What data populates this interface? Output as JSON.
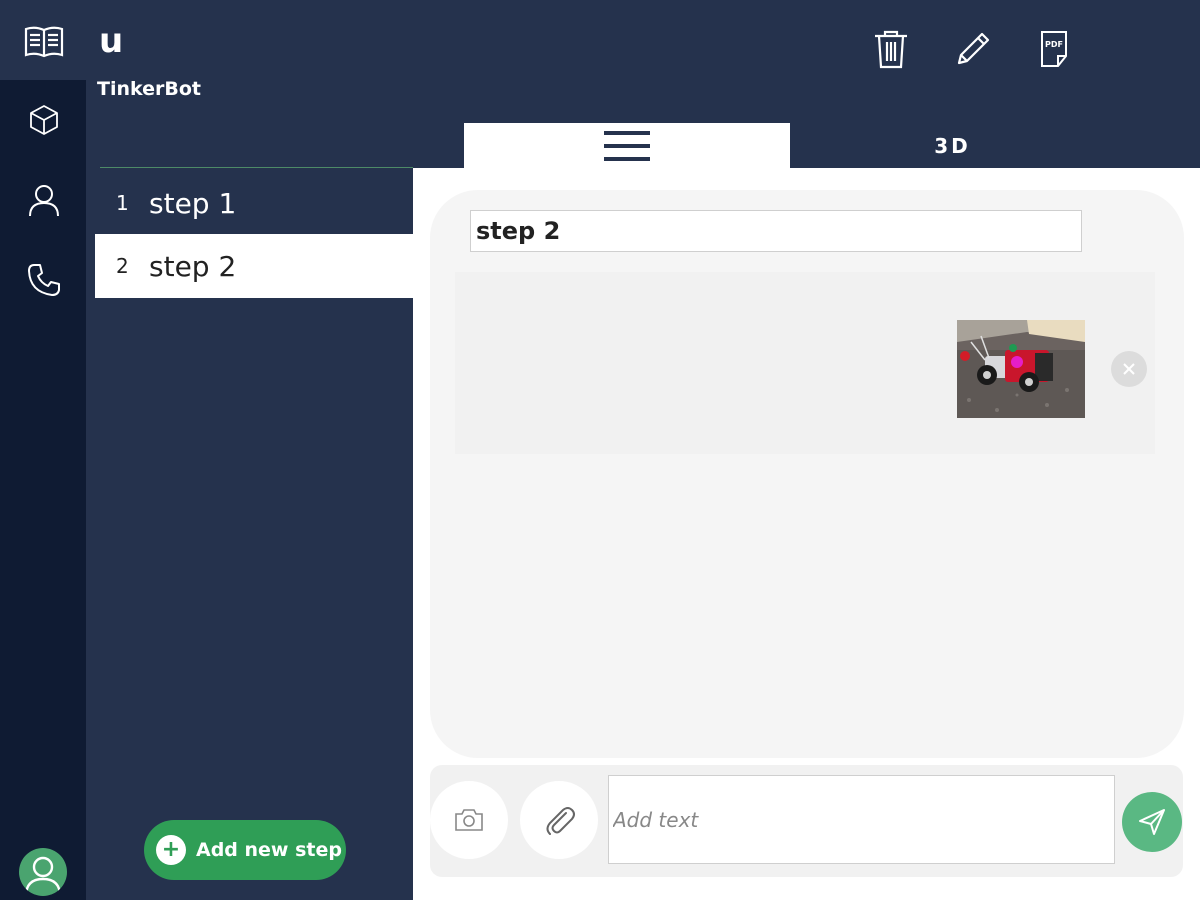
{
  "header": {
    "project_letter": "u",
    "project_name": "TinkerBot"
  },
  "nav_rail": {
    "icons": [
      "book-icon",
      "cube-icon",
      "user-icon",
      "phone-icon",
      "avatar"
    ]
  },
  "toolbar": {
    "icons": [
      "trash-icon",
      "pencil-icon",
      "pdf-icon"
    ]
  },
  "tabs": {
    "list_tab_icon": "hamburger-icon",
    "model_tab_label": "3D",
    "active": "list"
  },
  "steps": [
    {
      "number": "1",
      "label": "step 1"
    },
    {
      "number": "2",
      "label": "step 2"
    }
  ],
  "selected_step": "2",
  "add_step_label": "Add new step",
  "editor": {
    "title_value": "step 2",
    "image_alt": "robot car photo"
  },
  "composer": {
    "placeholder": "Add text",
    "camera_icon": "camera-icon",
    "attach_icon": "paperclip-icon",
    "send_icon": "send-icon"
  },
  "colors": {
    "navy": "#25324d",
    "dark_navy": "#0f1b33",
    "green": "#2f9e56",
    "light_green": "#5ab883"
  }
}
